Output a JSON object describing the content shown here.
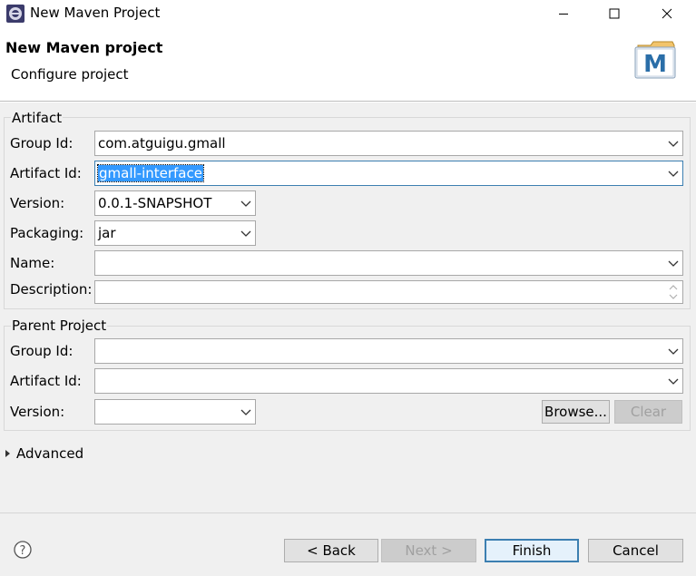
{
  "window": {
    "title": "New Maven Project"
  },
  "header": {
    "title": "New Maven project",
    "subtitle": "Configure project",
    "logo_letter": "M"
  },
  "artifact": {
    "legend": "Artifact",
    "group_id_label": "Group Id:",
    "group_id_value": "com.atguigu.gmall",
    "artifact_id_label": "Artifact Id:",
    "artifact_id_value": "gmall-interface",
    "version_label": "Version:",
    "version_value": "0.0.1-SNAPSHOT",
    "packaging_label": "Packaging:",
    "packaging_value": "jar",
    "name_label": "Name:",
    "name_value": "",
    "description_label": "Description:",
    "description_value": ""
  },
  "parent": {
    "legend": "Parent Project",
    "group_id_label": "Group Id:",
    "group_id_value": "",
    "artifact_id_label": "Artifact Id:",
    "artifact_id_value": "",
    "version_label": "Version:",
    "version_value": "",
    "browse_label": "Browse...",
    "clear_label": "Clear"
  },
  "advanced": {
    "label": "Advanced"
  },
  "footer": {
    "back_label": "< Back",
    "next_label": "Next >",
    "finish_label": "Finish",
    "cancel_label": "Cancel"
  },
  "icons": [
    "eclipse-app-icon",
    "minimize-icon",
    "maximize-icon",
    "close-icon",
    "maven-logo-icon",
    "chevron-down-icon",
    "spinner-icon",
    "expand-triangle-icon",
    "help-icon"
  ],
  "colors": {
    "selection": "#3399ff",
    "focus_border": "#3c7fb1",
    "panel_bg": "#f0f0f0"
  }
}
